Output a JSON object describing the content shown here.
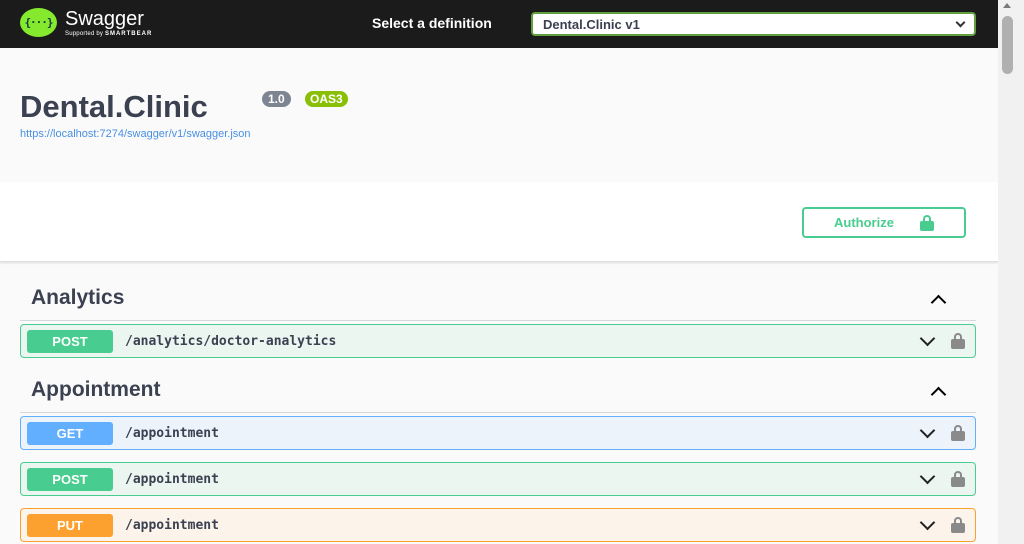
{
  "topbar": {
    "logo_name": "Swagger",
    "logo_sub_prefix": "Supported by",
    "logo_sub_brand": "SMARTBEAR",
    "select_label": "Select a definition",
    "select_value": "Dental.Clinic v1"
  },
  "info": {
    "title": "Dental.Clinic",
    "version": "1.0",
    "oas": "OAS3",
    "spec_url": "https://localhost:7274/swagger/v1/swagger.json"
  },
  "scheme": {
    "authorize_label": "Authorize"
  },
  "tags": [
    {
      "name": "Analytics",
      "operations": [
        {
          "method": "POST",
          "path": "/analytics/doctor-analytics"
        }
      ]
    },
    {
      "name": "Appointment",
      "operations": [
        {
          "method": "GET",
          "path": "/appointment"
        },
        {
          "method": "POST",
          "path": "/appointment"
        },
        {
          "method": "PUT",
          "path": "/appointment"
        }
      ]
    }
  ],
  "colors": {
    "post": "#49cc90",
    "get": "#61affe",
    "put": "#fca130",
    "brand": "#85ea2d",
    "topbar": "#1b1b1b"
  }
}
